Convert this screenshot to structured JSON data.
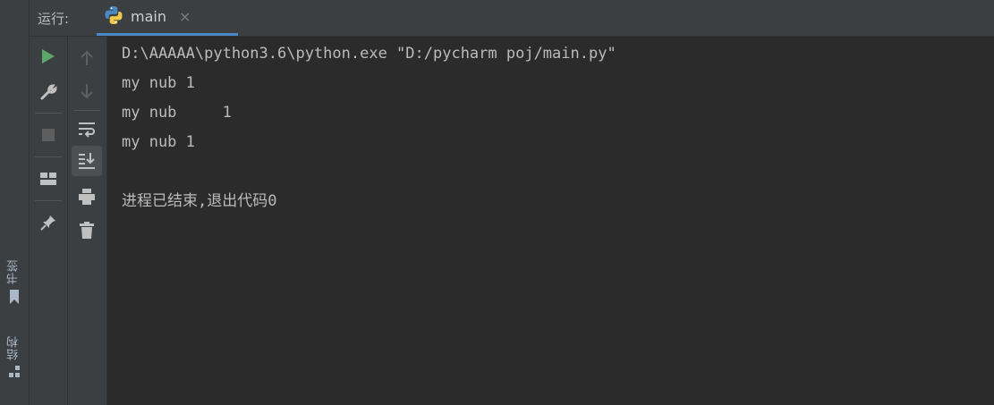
{
  "header": {
    "run_label": "运行:",
    "tab_label": "main",
    "close_glyph": "×"
  },
  "side_tabs": {
    "bookmarks": "书签",
    "structure": "结构"
  },
  "console": {
    "lines": [
      "D:\\AAAAA\\python3.6\\python.exe \"D:/pycharm poj/main.py\"",
      "my nub 1",
      "my nub     1",
      "my nub 1",
      "",
      "进程已结束,退出代码0"
    ]
  },
  "colors": {
    "accent": "#4a88c7",
    "run_green": "#59a869",
    "panel": "#3c3f41",
    "editor": "#2b2b2b"
  },
  "icons": {
    "toolbar1": [
      "run-icon",
      "wrench-icon",
      "stop-icon",
      "layout-icon",
      "pin-icon"
    ],
    "toolbar2": [
      "arrow-up-icon",
      "arrow-down-icon",
      "soft-wrap-icon",
      "scroll-to-end-icon",
      "print-icon",
      "trash-icon"
    ]
  }
}
